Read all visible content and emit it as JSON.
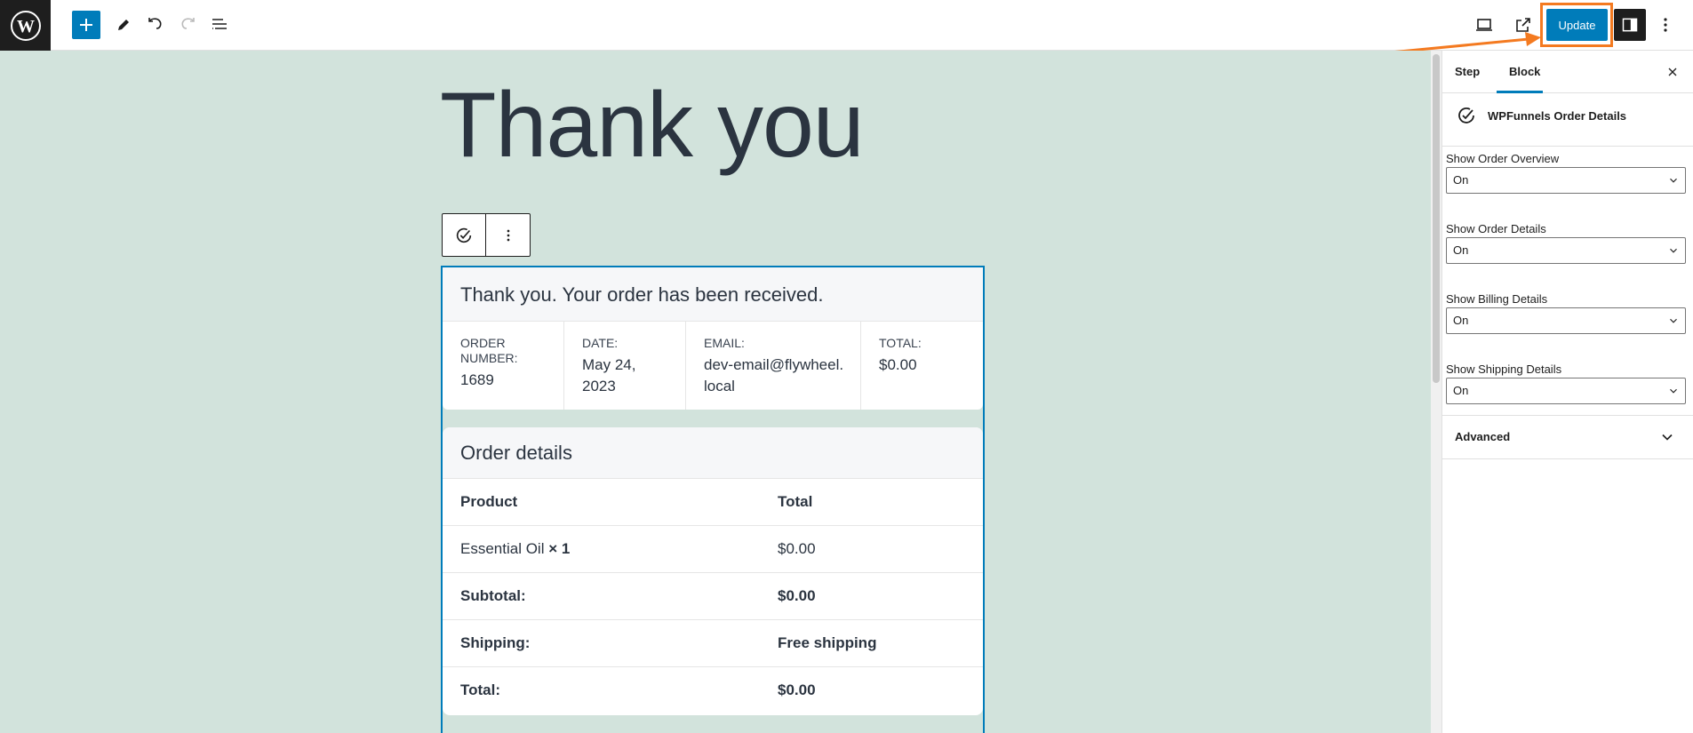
{
  "toolbar": {
    "update_label": "Update",
    "highlight_color": "#f47a20",
    "accent_color": "#007cba",
    "icons": [
      "wordpress-logo-icon",
      "plus-icon",
      "pencil-icon",
      "undo-icon",
      "redo-icon",
      "list-view-icon",
      "desktop-preview-icon",
      "external-link-icon",
      "sidebar-toggle-icon",
      "more-options-icon"
    ]
  },
  "canvas": {
    "background": "#d2e3dc",
    "heading": "Thank you",
    "received_message": "Thank you. Your order has been received.",
    "overview": [
      {
        "label": "ORDER NUMBER:",
        "value": "1689"
      },
      {
        "label": "DATE:",
        "value": "May 24, 2023"
      },
      {
        "label": "EMAIL:",
        "value": "dev-email@flywheel.local"
      },
      {
        "label": "TOTAL:",
        "value": "$0.00"
      }
    ],
    "order_details": {
      "title": "Order details",
      "header": {
        "product": "Product",
        "total": "Total"
      },
      "rows": [
        {
          "label": "Essential Oil",
          "qty": "× 1",
          "value": "$0.00"
        },
        {
          "label": "Subtotal:",
          "value": "$0.00"
        },
        {
          "label": "Shipping:",
          "value": "Free shipping"
        },
        {
          "label": "Total:",
          "value": "$0.00"
        }
      ]
    }
  },
  "sidebar": {
    "tabs": [
      {
        "label": "Step"
      },
      {
        "label": "Block"
      }
    ],
    "active_tab": "Block",
    "block_name": "WPFunnels Order Details",
    "fields": [
      {
        "label": "Show Order Overview",
        "value": "On"
      },
      {
        "label": "Show Order Details",
        "value": "On"
      },
      {
        "label": "Show Billing Details",
        "value": "On"
      },
      {
        "label": "Show Shipping Details",
        "value": "On"
      }
    ],
    "advanced_label": "Advanced"
  }
}
